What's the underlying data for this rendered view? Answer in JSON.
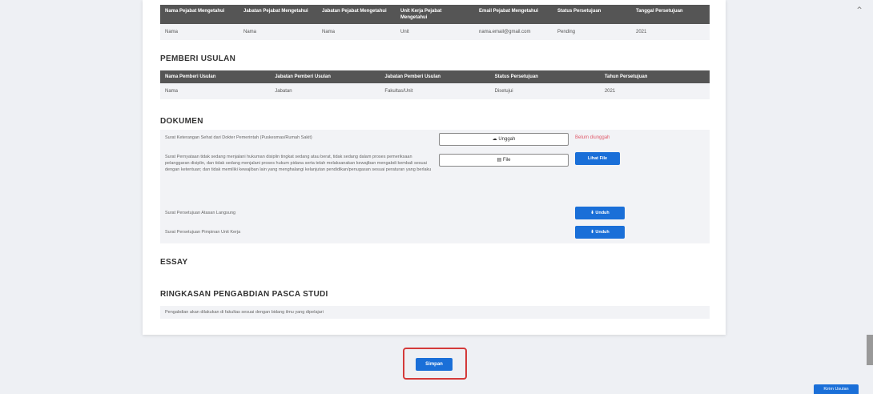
{
  "top_table": {
    "headers": [
      "Nama Pejabat Mengetahui",
      "Jabatan Pejabat Mengetahui",
      "Jabatan Pejabat Mengetahui",
      "Unit Kerja Pejabat Mengetahui",
      "Email Pejabat Mengetahui",
      "Status Persetujuan",
      "Tanggal Persetujuan"
    ],
    "row": [
      "Nama",
      "Nama",
      "Nama",
      "Unit",
      "nama.email@gmail.com",
      "Pending",
      "2021"
    ]
  },
  "pemberi_usulan": {
    "title": "PEMBERI USULAN",
    "headers": [
      "Nama Pemberi Usulan",
      "Jabatan Pemberi Usulan",
      "Jabatan Pemberi Usulan",
      "Status Persetujuan",
      "Tahun Persetujuan"
    ],
    "row": [
      "Nama",
      "Jabatan",
      "Fakultas/Unit",
      "Disetujui",
      "2021"
    ]
  },
  "dokumen": {
    "title": "DOKUMEN",
    "items": [
      {
        "text": "Surat Keterangan Sehat dari Dokter Pemerintah (Puskesmas/Rumah Sakit)"
      },
      {
        "text": "Surat Pernyataan tidak sedang menjalani hukuman disiplin tingkat sedang atau berat, tidak sedang dalam proses pemeriksaan pelanggaran disiplin, dan tidak sedang menjalani proses hukum pidana serta telah melaksanakan kewajiban mengabdi kembali sesuai dengan ketentuan; dan tidak memiliki kewajiban lain yang menghalangi kelanjutan pendidikan/penugasan sesuai peraturan yang berlaku"
      },
      {
        "text": "Surat Persetujuan Atasan Langsung"
      },
      {
        "text": "Surat Persetujuan Pimpinan Unit Kerja"
      }
    ],
    "upload1_label": "Unggah",
    "upload1_error": "Belum diunggah",
    "upload2_label": "File",
    "lihat_label": "Lihat File",
    "download_label": "Unduh"
  },
  "essay": {
    "title": "ESSAY"
  },
  "ringkasan": {
    "title": "RINGKASAN PENGABDIAN PASCA STUDI",
    "text": "Pengabdian akan dilakukan di fakultas sesuai dengan bidang ilmu yang dipelajari"
  },
  "submit_label": "Simpan",
  "fab_label": "Kirim Usulan"
}
